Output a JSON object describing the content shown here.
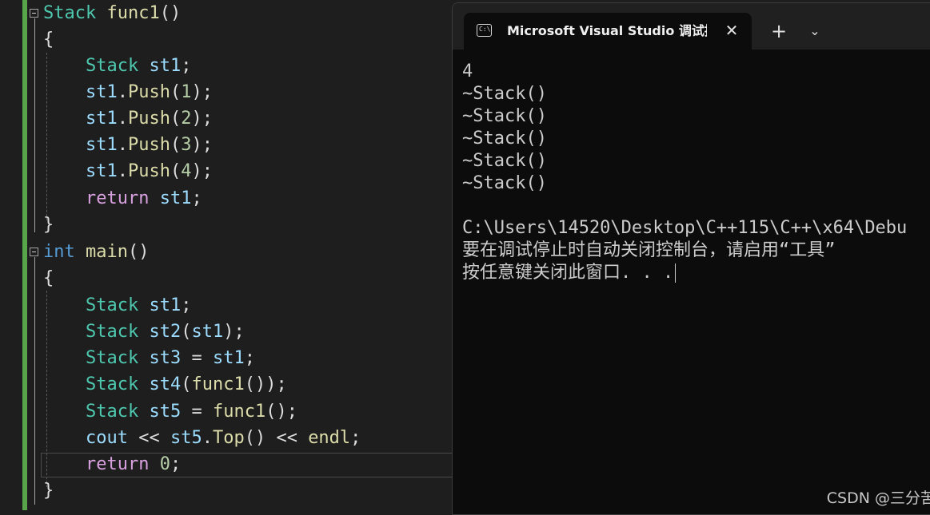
{
  "editor": {
    "func1": {
      "sig": {
        "type": "Stack",
        "name": "func1",
        "parens": "()"
      },
      "open": "{",
      "decl": {
        "type": "Stack",
        "var": "st1",
        "semi": ";"
      },
      "push1": {
        "obj": "st1",
        "dot": ".",
        "fn": "Push",
        "lp": "(",
        "arg": "1",
        "rp": ");"
      },
      "push2": {
        "obj": "st1",
        "dot": ".",
        "fn": "Push",
        "lp": "(",
        "arg": "2",
        "rp": ");"
      },
      "push3": {
        "obj": "st1",
        "dot": ".",
        "fn": "Push",
        "lp": "(",
        "arg": "3",
        "rp": ");"
      },
      "push4": {
        "obj": "st1",
        "dot": ".",
        "fn": "Push",
        "lp": "(",
        "arg": "4",
        "rp": ");"
      },
      "ret": {
        "kw": "return",
        "var": "st1",
        "semi": ";"
      },
      "close": "}"
    },
    "main": {
      "sig": {
        "type": "int",
        "name": "main",
        "parens": "()"
      },
      "open": "{",
      "l1": {
        "type": "Stack",
        "var": "st1",
        "semi": ";"
      },
      "l2": {
        "type": "Stack",
        "var": "st2",
        "lp": "(",
        "arg": "st1",
        "rp": ");"
      },
      "l3": {
        "type": "Stack",
        "var": "st3",
        "op": " = ",
        "arg": "st1",
        "semi": ";"
      },
      "l4": {
        "type": "Stack",
        "var": "st4",
        "lp": "(",
        "fn": "func1",
        "rp": "());"
      },
      "l5": {
        "type": "Stack",
        "var": "st5",
        "op": " = ",
        "fn": "func1",
        "rp": "();"
      },
      "l6": {
        "cout": "cout",
        "op1": " << ",
        "obj": "st5",
        "dot": ".",
        "fn": "Top",
        "paren": "()",
        "op2": " << ",
        "endl": "endl",
        "semi": ";"
      },
      "ret": {
        "kw": "return",
        "num": "0",
        "semi": ";"
      },
      "close": "}"
    }
  },
  "terminal": {
    "tab_title": "Microsoft Visual Studio 调试控",
    "tab_icon_text": "C:\\",
    "close_glyph": "✕",
    "new_tab_glyph": "+",
    "dropdown_glyph": "⌄",
    "output": [
      "4",
      "~Stack()",
      "~Stack()",
      "~Stack()",
      "~Stack()",
      "~Stack()",
      "",
      "C:\\Users\\14520\\Desktop\\C++115\\C++\\x64\\Debu",
      "要在调试停止时自动关闭控制台，请启用“工具”",
      "按任意键关闭此窗口. . ."
    ]
  },
  "watermark": "CSDN @三分苦"
}
